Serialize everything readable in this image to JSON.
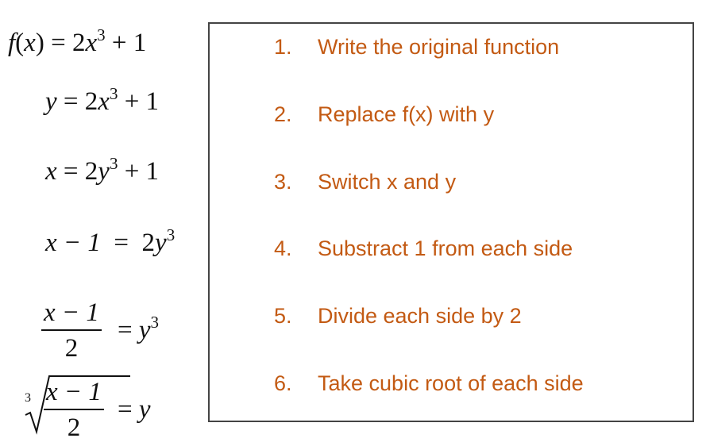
{
  "equations": [
    {
      "lhs": "f",
      "arg": "x",
      "rhs_coef": "2",
      "rhs_var": "x",
      "rhs_exp": "3",
      "rhs_tail": "+ 1"
    },
    {
      "lhs": "y",
      "rhs_coef": "2",
      "rhs_var": "x",
      "rhs_exp": "3",
      "rhs_tail": "+ 1"
    },
    {
      "lhs": "x",
      "rhs_coef": "2",
      "rhs_var": "y",
      "rhs_exp": "3",
      "rhs_tail": "+ 1"
    },
    {
      "lhs": "x − 1",
      "rhs_coef": "2",
      "rhs_var": "y",
      "rhs_exp": "3"
    },
    {
      "numerator": "x − 1",
      "denominator": "2",
      "rhs_var": "y",
      "rhs_exp": "3"
    },
    {
      "root_index": "3",
      "numerator": "x − 1",
      "denominator": "2",
      "rhs_var": "y"
    }
  ],
  "steps": [
    {
      "number": "1.",
      "text": "Write the original function"
    },
    {
      "number": "2.",
      "text": "Replace f(x) with y"
    },
    {
      "number": "3.",
      "text": "Switch x and y"
    },
    {
      "number": "4.",
      "text": "Substract 1 from each side"
    },
    {
      "number": "5.",
      "text": "Divide each side by 2"
    },
    {
      "number": "6.",
      "text": "Take cubic root of each side"
    }
  ],
  "colors": {
    "step_text": "#c35a13",
    "math_text": "#111111",
    "box_border": "#444444"
  }
}
